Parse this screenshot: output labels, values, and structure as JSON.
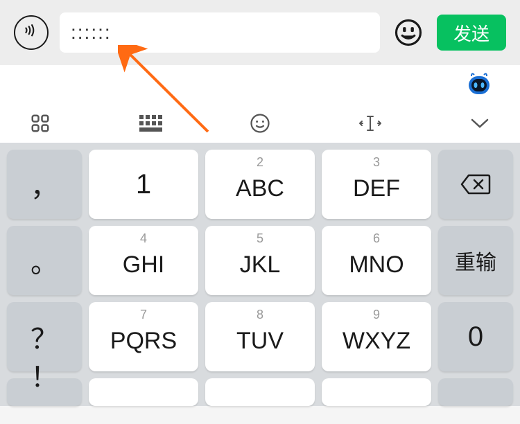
{
  "chat": {
    "input_value": "::::::",
    "send_label": "发送"
  },
  "keyboard": {
    "keys": {
      "k_comma": "，",
      "k_1": "1",
      "k_2_sup": "2",
      "k_2": "ABC",
      "k_3_sup": "3",
      "k_3": "DEF",
      "k_dot": "。",
      "k_4_sup": "4",
      "k_4": "GHI",
      "k_5_sup": "5",
      "k_5": "JKL",
      "k_6_sup": "6",
      "k_6": "MNO",
      "k_retype": "重输",
      "k_q": "？",
      "k_7_sup": "7",
      "k_7": "PQRS",
      "k_8_sup": "8",
      "k_8": "TUV",
      "k_9_sup": "9",
      "k_9": "WXYZ",
      "k_0": "0",
      "k_excl": "！"
    }
  }
}
